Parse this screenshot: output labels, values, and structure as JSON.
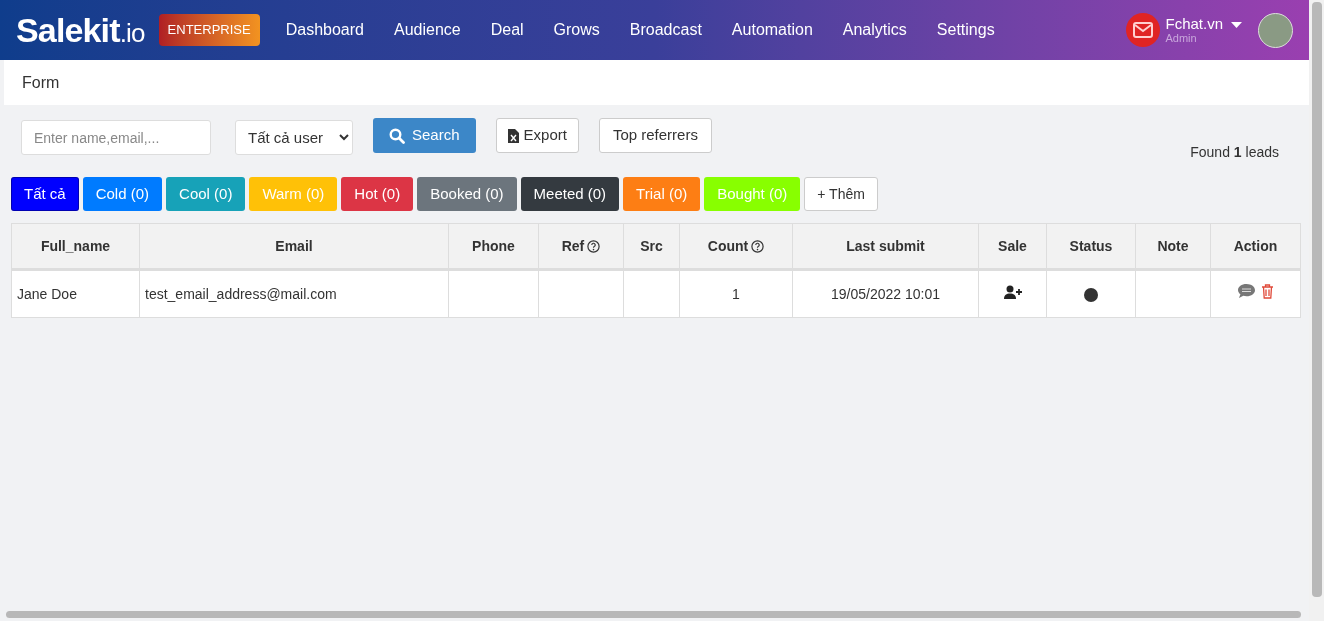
{
  "navbar": {
    "logo": "Salekit",
    "logo_suffix": ".io",
    "plan_badge": "ENTERPRISE",
    "menu": [
      {
        "label": "Dashboard",
        "selected": false
      },
      {
        "label": "Audience",
        "selected": false
      },
      {
        "label": "Deal",
        "selected": false
      },
      {
        "label": "Grows",
        "selected": false
      },
      {
        "label": "Broadcast",
        "selected": false
      },
      {
        "label": "Automation",
        "selected": false
      },
      {
        "label": "Analytics",
        "selected": false
      },
      {
        "label": "Settings",
        "selected": false
      }
    ],
    "user": {
      "name": "Fchat.vn",
      "role": "Admin"
    }
  },
  "breadcrumb": "Form",
  "toolbar": {
    "search_placeholder": "Enter name,email,...",
    "user_filter": "Tất cả user",
    "search_button": "Search",
    "export_button": "Export",
    "referrers_button": "Top referrers",
    "found_prefix": "Found ",
    "found_count": "1",
    "found_suffix": " leads"
  },
  "filters": [
    {
      "kind": "status",
      "label": "Tất cả",
      "color": "#0000ff",
      "selected": true
    },
    {
      "kind": "status",
      "label": "Cold (0)",
      "color": "#007bff",
      "selected": false
    },
    {
      "kind": "status",
      "label": "Cool (0)",
      "color": "#17a2b8",
      "selected": false
    },
    {
      "kind": "status",
      "label": "Warm (0)",
      "color": "#ffc107",
      "selected": false
    },
    {
      "kind": "status",
      "label": "Hot (0)",
      "color": "#dc3545",
      "selected": false
    },
    {
      "kind": "status",
      "label": "Booked (0)",
      "color": "#6c757d",
      "selected": false
    },
    {
      "kind": "status",
      "label": "Meeted (0)",
      "color": "#343a40",
      "selected": false
    },
    {
      "kind": "status",
      "label": "Trial (0)",
      "color": "#fd7e14",
      "selected": false
    },
    {
      "kind": "status",
      "label": "Bought (0)",
      "color": "#88ff00",
      "selected": false
    },
    {
      "kind": "add",
      "label": "+ Thêm"
    }
  ],
  "table": {
    "columns": [
      {
        "label": "Full_name",
        "help": false
      },
      {
        "label": "Email",
        "help": false
      },
      {
        "label": "Phone",
        "help": false
      },
      {
        "label": "Ref",
        "help": true
      },
      {
        "label": "Src",
        "help": false
      },
      {
        "label": "Count",
        "help": true
      },
      {
        "label": "Last submit",
        "help": false
      },
      {
        "label": "Sale",
        "help": false
      },
      {
        "label": "Status",
        "help": false
      },
      {
        "label": "Note",
        "help": false
      },
      {
        "label": "Action",
        "help": false
      }
    ],
    "rows": [
      {
        "full_name": "Jane Doe",
        "email": "test_email_address@mail.com",
        "count": "1",
        "last_submit": "19/05/2022 10:01",
        "color": "#333333"
      }
    ]
  }
}
